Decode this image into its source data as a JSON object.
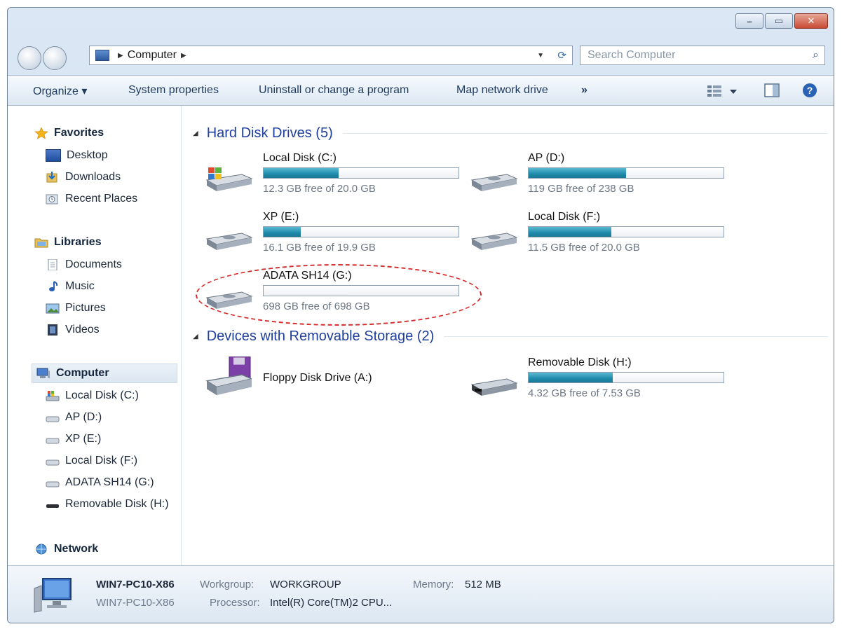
{
  "window": {
    "controls": {
      "minimize": "–",
      "maximize": "▭",
      "close": "✕"
    }
  },
  "address_bar": {
    "segments": [
      "Computer"
    ],
    "search_placeholder": "Search Computer"
  },
  "toolbar": {
    "organize": "Organize ▾",
    "system_properties": "System properties",
    "uninstall": "Uninstall or change a program",
    "map_drive": "Map network drive",
    "more": "»"
  },
  "sidebar": {
    "favorites": {
      "label": "Favorites",
      "items": [
        "Desktop",
        "Downloads",
        "Recent Places"
      ]
    },
    "libraries": {
      "label": "Libraries",
      "items": [
        "Documents",
        "Music",
        "Pictures",
        "Videos"
      ]
    },
    "computer": {
      "label": "Computer",
      "items": [
        "Local Disk (C:)",
        "AP (D:)",
        "XP (E:)",
        "Local Disk (F:)",
        "ADATA SH14 (G:)",
        "Removable Disk (H:)"
      ]
    },
    "network": {
      "label": "Network"
    }
  },
  "hard_disks": {
    "title": "Hard Disk Drives (5)",
    "drives": [
      {
        "name": "Local Disk (C:)",
        "free": "12.3 GB free of 20.0 GB",
        "used_fraction": 0.385
      },
      {
        "name": "AP (D:)",
        "free": "119 GB free of 238 GB",
        "used_fraction": 0.5
      },
      {
        "name": "XP (E:)",
        "free": "16.1 GB free of 19.9 GB",
        "used_fraction": 0.19
      },
      {
        "name": "Local Disk (F:)",
        "free": "11.5 GB free of 20.0 GB",
        "used_fraction": 0.425
      },
      {
        "name": "ADATA SH14 (G:)",
        "free": "698 GB free of 698 GB",
        "used_fraction": 0.0
      }
    ]
  },
  "removable": {
    "title": "Devices with Removable Storage (2)",
    "devices": [
      {
        "name": "Floppy Disk Drive (A:)"
      },
      {
        "name": "Removable Disk (H:)",
        "free": "4.32 GB free of 7.53 GB",
        "used_fraction": 0.43
      }
    ]
  },
  "details": {
    "pc_name": "WIN7-PC10-X86",
    "pc_name_sub": "WIN7-PC10-X86",
    "workgroup_label": "Workgroup:",
    "workgroup_value": "WORKGROUP",
    "memory_label": "Memory:",
    "memory_value": "512 MB",
    "processor_label": "Processor:",
    "processor_value": "Intel(R) Core(TM)2 CPU..."
  },
  "colors": {
    "accent": "#1e3f9c",
    "bar_fill": "#1f8bab",
    "highlight": "#d62b2b"
  }
}
